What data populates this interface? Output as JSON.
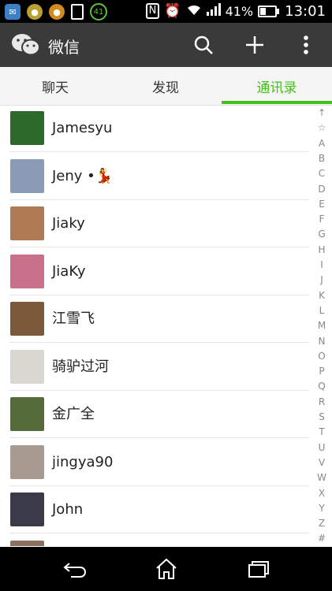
{
  "status_bar": {
    "signal_percent": "41%",
    "time": "13:01",
    "left_icons": [
      "chat-app-icon",
      "app-icon-yellow",
      "app-icon-orange",
      "phone-icon",
      "badge-41-icon"
    ],
    "badge": "41",
    "battery_level": 0.41
  },
  "app_bar": {
    "title": "微信",
    "actions": [
      "search-icon",
      "plus-icon",
      "more-icon"
    ]
  },
  "tabs": [
    {
      "label": "聊天",
      "active": false
    },
    {
      "label": "发现",
      "active": false
    },
    {
      "label": "通讯录",
      "active": true
    }
  ],
  "contacts": [
    {
      "name": "Jamesyu",
      "avatar_color": "#2b6a2b"
    },
    {
      "name": "Jeny •💃",
      "avatar_color": "#8a9bb5"
    },
    {
      "name": "Jiaky",
      "avatar_color": "#b07a55"
    },
    {
      "name": "JiaKy",
      "avatar_color": "#c9708a"
    },
    {
      "name": "江雪飞",
      "avatar_color": "#7a5a3a"
    },
    {
      "name": "骑驴过河",
      "avatar_color": "#d8d8d0"
    },
    {
      "name": "金广全",
      "avatar_color": "#556b3a"
    },
    {
      "name": "jingya90",
      "avatar_color": "#a89a90"
    },
    {
      "name": "John",
      "avatar_color": "#3a3a48"
    },
    {
      "name": "",
      "avatar_color": "#8b7060"
    }
  ],
  "index_letters": [
    "↑",
    "☆",
    "A",
    "B",
    "C",
    "D",
    "E",
    "F",
    "G",
    "H",
    "I",
    "J",
    "K",
    "L",
    "M",
    "N",
    "O",
    "P",
    "Q",
    "R",
    "S",
    "T",
    "U",
    "V",
    "W",
    "X",
    "Y",
    "Z",
    "#"
  ],
  "nav_bar": [
    "back-icon",
    "home-icon",
    "recents-icon"
  ],
  "colors": {
    "accent": "#45c01a",
    "app_bar": "#3a3a3a"
  }
}
